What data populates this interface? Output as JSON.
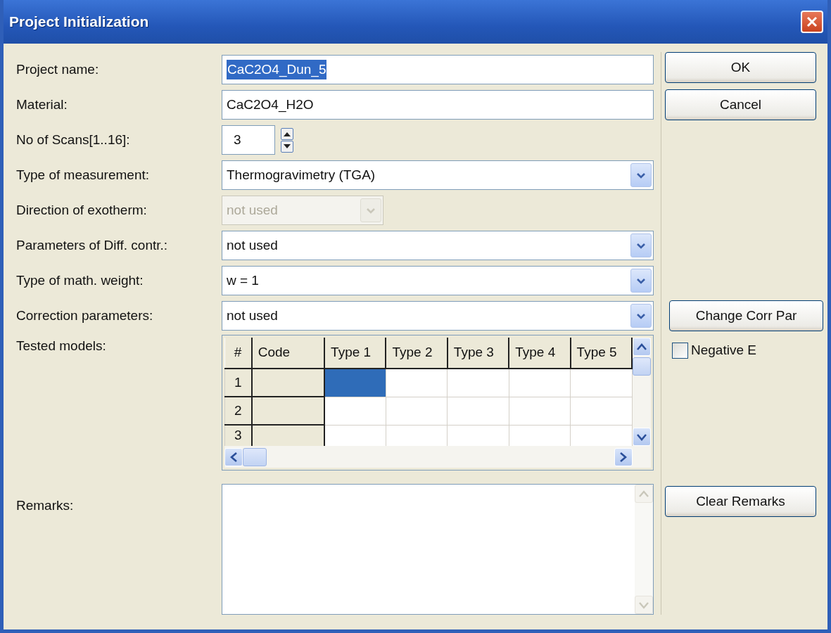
{
  "window": {
    "title": "Project Initialization"
  },
  "fields": [
    {
      "kind": "text",
      "label": "Project name:",
      "value": "CaC2O4_Dun_5",
      "text_selected": true
    },
    {
      "kind": "text",
      "label": "Material:",
      "value": "CaC2O4_H2O",
      "text_selected": false
    },
    {
      "kind": "spin",
      "label": "No of Scans[1..16]:",
      "value": "3"
    },
    {
      "kind": "dropdown",
      "label": "Type of measurement:",
      "value": "Thermogravimetry (TGA)",
      "disabled": false
    },
    {
      "kind": "dropdown",
      "label": "Direction of exotherm:",
      "value": "not used",
      "disabled": true
    },
    {
      "kind": "dropdown",
      "label": "Parameters of Diff. contr.:",
      "value": "not used",
      "disabled": false
    },
    {
      "kind": "dropdown",
      "label": "Type of math. weight:",
      "value": "w = 1",
      "disabled": false
    },
    {
      "kind": "dropdown",
      "label": "Correction parameters:",
      "value": "not used",
      "disabled": false
    }
  ],
  "models_grid": {
    "label": "Tested models:",
    "columns": [
      "#",
      "Code",
      "Type 1",
      "Type 2",
      "Type 3",
      "Type 4",
      "Type 5"
    ],
    "rows": [
      {
        "number": "1",
        "cells": [
          {
            "selected": true
          },
          {
            "selected": false
          },
          {
            "selected": false
          },
          {
            "selected": false
          },
          {
            "selected": false
          }
        ]
      },
      {
        "number": "2",
        "cells": [
          {
            "selected": false
          },
          {
            "selected": false
          },
          {
            "selected": false
          },
          {
            "selected": false
          },
          {
            "selected": false
          }
        ]
      },
      {
        "number": "3",
        "cells": [
          {
            "selected": false
          },
          {
            "selected": false
          },
          {
            "selected": false
          },
          {
            "selected": false
          },
          {
            "selected": false
          }
        ]
      }
    ]
  },
  "remarks": {
    "label": "Remarks:"
  },
  "buttons": [
    {
      "label": "OK"
    },
    {
      "label": "Cancel"
    }
  ],
  "change_corr_button": {
    "label": "Change Corr Par"
  },
  "negative_e": {
    "label": "Negative E",
    "checked": false
  },
  "clear_remarks_button": {
    "label": "Clear Remarks"
  }
}
